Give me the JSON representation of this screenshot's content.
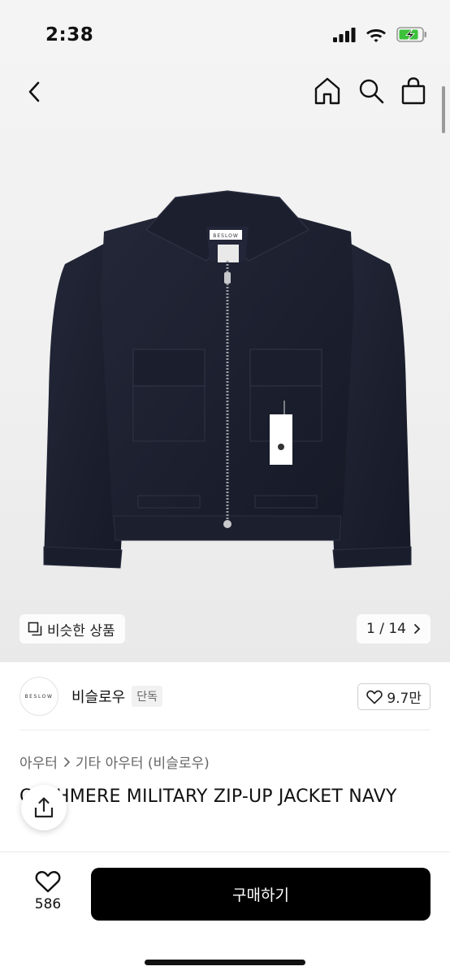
{
  "status_bar": {
    "time": "2:38",
    "icons": [
      "signal-icon",
      "wifi-icon",
      "battery-charging-icon"
    ],
    "battery_color": "#3cc13b"
  },
  "nav": {
    "icons": [
      "back-chevron-icon",
      "home-icon",
      "search-icon",
      "shopping-bag-icon"
    ]
  },
  "gallery": {
    "similar_label": "비슷한 상품",
    "counter": "1 / 14",
    "product_image": "navy-zip-up-jacket",
    "brand_label_on_tag": "BESLOW"
  },
  "brand": {
    "logo_text": "BESLOW",
    "name": "비슬로우",
    "badge": "단독",
    "likes": "9.7만"
  },
  "breadcrumb": {
    "items": [
      "아우터",
      "기타 아우터 (비슬로우)"
    ]
  },
  "product": {
    "title": "CASHMERE MILITARY ZIP-UP JACKET NAVY"
  },
  "bottom_bar": {
    "wish_count": "586",
    "buy_label": "구매하기"
  },
  "colors": {
    "accent": "#000000",
    "jacket": "#1b1e2b"
  }
}
